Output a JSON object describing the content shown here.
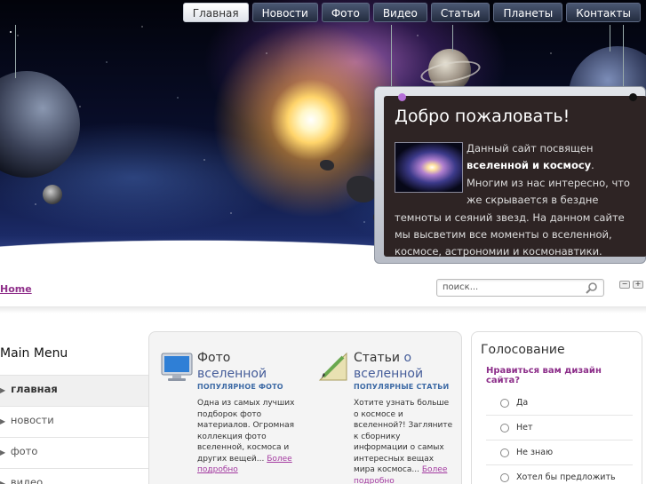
{
  "nav": {
    "items": [
      "Главная",
      "Новости",
      "Фото",
      "Видео",
      "Статьи",
      "Планеты",
      "Контакты"
    ]
  },
  "welcome": {
    "title": "Добро пожаловать!",
    "text_before": "Данный сайт посвящен ",
    "text_bold": "вселенной и космосу",
    "text_after": ". Многим из нас интересно, что же скрывается в бездне темноты и сеяний звезд. На данном сайте мы высветим все моменты о вселенной, космосе, астрономии и космонавтики."
  },
  "breadcrumb": "Home",
  "search": {
    "placeholder": "поиск..."
  },
  "text_size": {
    "minus": "−",
    "plus": "+"
  },
  "main_menu": {
    "title": "Main Menu",
    "items": [
      "главная",
      "новости",
      "фото",
      "видео"
    ]
  },
  "columns": [
    {
      "title_a": "Фото",
      "title_b": "вселенной",
      "subtitle": "ПОПУЛЯРНОЕ ФОТО",
      "text": "Одна из самых лучших подборок фото материалов. Огромная коллекция фото вселенной, космоса и других вещей...",
      "more": "Более подробно",
      "icon": "monitor-icon"
    },
    {
      "title_a": "Статьи",
      "title_o": "о",
      "title_b": "вселенной",
      "subtitle": "ПОПУЛЯРНЫЕ СТАТЬИ",
      "text": "Хотите узнать больше о космосе и вселенной?! Загляните к сборнику информации о самых интересных вещах мира космоса...",
      "more": "Более подробно",
      "icon": "pencil-ruler-icon"
    }
  ],
  "poll": {
    "title": "Голосование",
    "question": "Нравиться вам дизайн сайта?",
    "options": [
      "Да",
      "Нет",
      "Не знаю",
      "Хотел бы предложить дополнения"
    ]
  }
}
